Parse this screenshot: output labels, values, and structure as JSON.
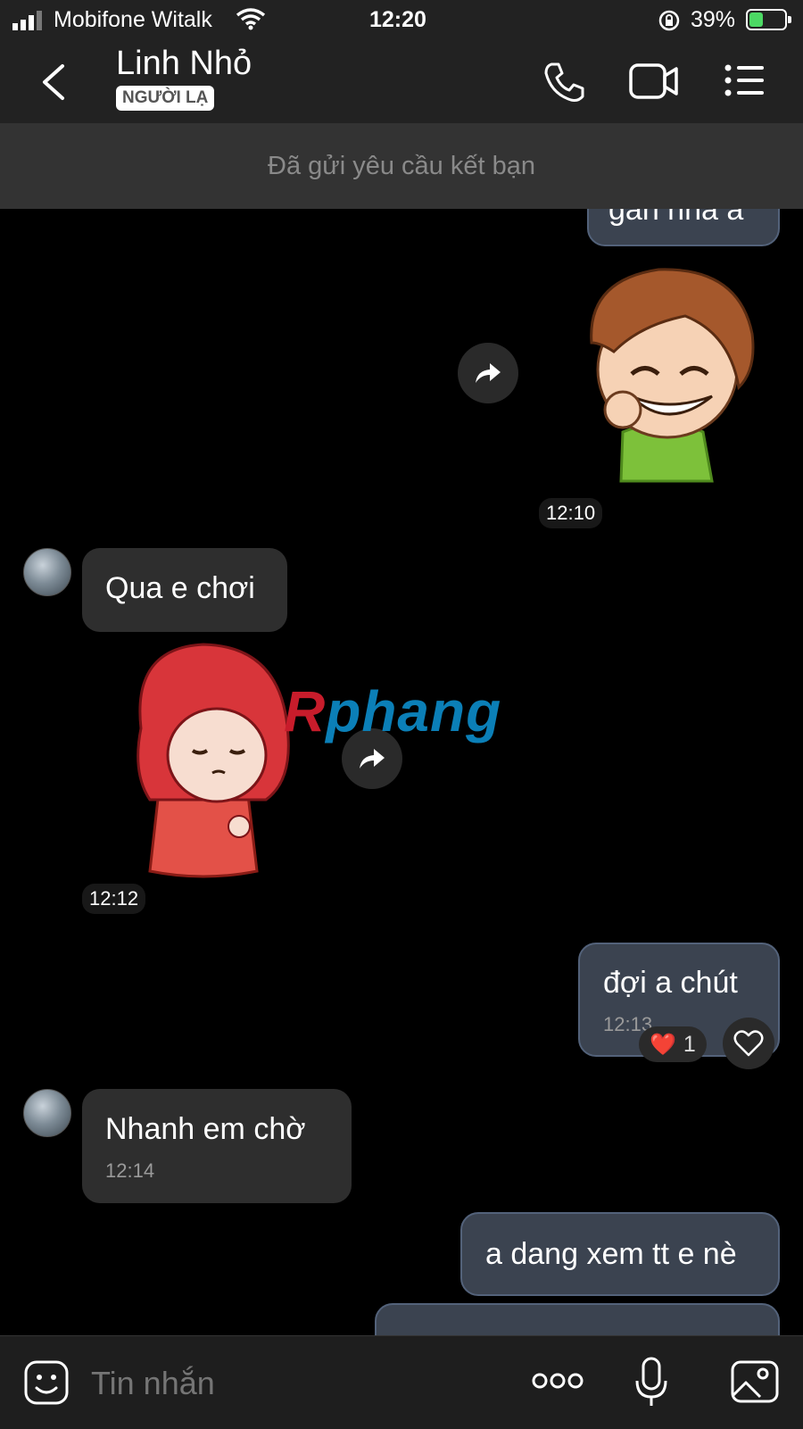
{
  "status_bar": {
    "carrier": "Mobifone Witalk",
    "time": "12:20",
    "battery": "39%",
    "battery_level": 0.39
  },
  "header": {
    "contact_name": "Linh Nhỏ",
    "badge": "NGƯỜI LẠ",
    "icons": [
      "back-icon",
      "phone-icon",
      "video-icon",
      "menu-icon"
    ]
  },
  "banner": {
    "text": "Đã gửi yêu cầu kết bạn"
  },
  "messages": {
    "partial_out": {
      "text": "gần nha a"
    },
    "sticker1_time": "12:10",
    "in1": {
      "text": "Qua e chơi"
    },
    "sticker2_time": "12:12",
    "out1": {
      "text": "đợi a chút",
      "time": "12:13"
    },
    "reaction": {
      "emoji": "❤️",
      "count": "1"
    },
    "in2": {
      "text": "Nhanh em chờ",
      "time": "12:14"
    },
    "out2": {
      "text": "a dang xem tt e nè"
    }
  },
  "watermark": {
    "prefix": "R",
    "rest": "phang"
  },
  "input": {
    "placeholder": "Tin nhắn",
    "icons": [
      "sticker-icon",
      "more-icon",
      "microphone-icon",
      "image-icon"
    ]
  },
  "colors": {
    "accent_battery": "#4cd964",
    "bubble_out": "#3b4350",
    "bubble_in": "#2e2e2e",
    "header_bg": "#222222",
    "heart": "#e0242f"
  }
}
